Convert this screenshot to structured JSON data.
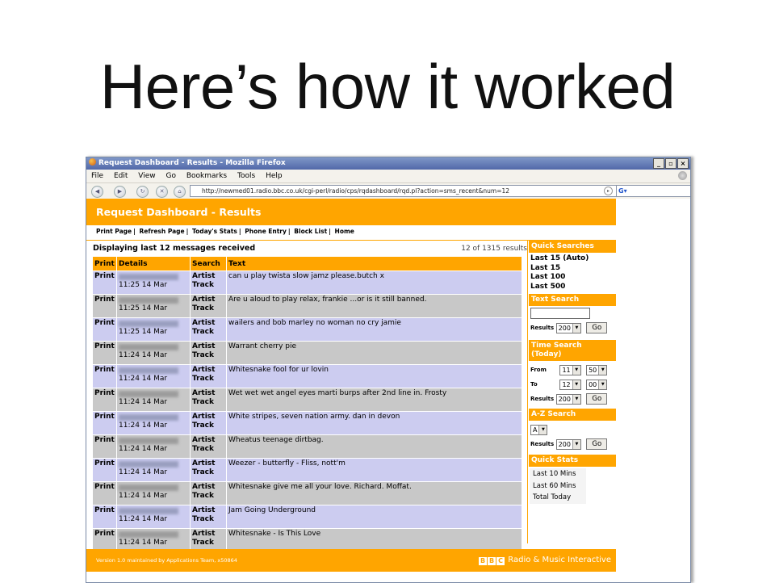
{
  "slide": {
    "title": "Here’s how it worked"
  },
  "window": {
    "title": "Request Dashboard - Results - Mozilla Firefox",
    "menu": [
      "File",
      "Edit",
      "View",
      "Go",
      "Bookmarks",
      "Tools",
      "Help"
    ],
    "url": "http://newmed01.radio.bbc.co.uk/cgi-perl/radio/cps/rqdashboard/rqd.pl?action=sms_recent&num=12",
    "search_logo": "G"
  },
  "page": {
    "header": "Request Dashboard - Results",
    "links": [
      "Print Page",
      "Refresh Page",
      "Today's Stats",
      "Phone Entry",
      "Block List",
      "Home"
    ],
    "display_heading": "Displaying last 12 messages received",
    "result_count": "12 of 1315 results",
    "columns": [
      "Print",
      "Details",
      "Search",
      "Text"
    ],
    "rows": [
      {
        "print": "Print",
        "time": "11:25 14 Mar",
        "s1": "Artist",
        "s2": "Track",
        "text": "can u play twista slow jamz please.butch x"
      },
      {
        "print": "Print",
        "time": "11:25 14 Mar",
        "s1": "Artist",
        "s2": "Track",
        "text": "Are u aloud to play relax, frankie ...or is it still banned."
      },
      {
        "print": "Print",
        "time": "11:25 14 Mar",
        "s1": "Artist",
        "s2": "Track",
        "text": "wailers and bob marley no woman no cry jamie"
      },
      {
        "print": "Print",
        "time": "11:24 14 Mar",
        "s1": "Artist",
        "s2": "Track",
        "text": "Warrant cherry pie"
      },
      {
        "print": "Print",
        "time": "11:24 14 Mar",
        "s1": "Artist",
        "s2": "Track",
        "text": "Whitesnake fool for ur lovin"
      },
      {
        "print": "Print",
        "time": "11:24 14 Mar",
        "s1": "Artist",
        "s2": "Track",
        "text": "Wet wet wet angel eyes marti burps after 2nd line in. Frosty"
      },
      {
        "print": "Print",
        "time": "11:24 14 Mar",
        "s1": "Artist",
        "s2": "Track",
        "text": "White stripes, seven nation army. dan in devon"
      },
      {
        "print": "Print",
        "time": "11:24 14 Mar",
        "s1": "Artist",
        "s2": "Track",
        "text": "Wheatus teenage dirtbag."
      },
      {
        "print": "Print",
        "time": "11:24 14 Mar",
        "s1": "Artist",
        "s2": "Track",
        "text": "Weezer - butterfly - Fliss, nott'm"
      },
      {
        "print": "Print",
        "time": "11:24 14 Mar",
        "s1": "Artist",
        "s2": "Track",
        "text": "Whitesnake give me all your love. Richard. Moffat."
      },
      {
        "print": "Print",
        "time": "11:24 14 Mar",
        "s1": "Artist",
        "s2": "Track",
        "text": "Jam Going Underground"
      },
      {
        "print": "Print",
        "time": "11:24 14 Mar",
        "s1": "Artist",
        "s2": "Track",
        "text": "Whitesnake - Is This Love"
      }
    ],
    "sidebar": {
      "quick_title": "Quick Searches",
      "quick_links": [
        "Last 15 (Auto)",
        "Last 15",
        "Last 100",
        "Last 500"
      ],
      "text_title": "Text Search",
      "results_label": "Results",
      "results_value": "200",
      "go": "Go",
      "time_title": "Time Search (Today)",
      "from_label": "From",
      "from_hour": "11",
      "from_min": "50",
      "to_label": "To",
      "to_hour": "12",
      "to_min": "00",
      "az_title": "A-Z Search",
      "az_value": "A",
      "stats_title": "Quick Stats",
      "stats": [
        "Last 10 Mins",
        "Last 60 Mins",
        "Total Today"
      ]
    },
    "footer": {
      "left": "Version 1.0 maintained by Applications Team, x50864",
      "bbc": "BBC",
      "right": "Radio & Music Interactive"
    }
  },
  "colors": {
    "accent": "#ffa500",
    "row_blue": "#ccccf0",
    "row_grey": "#c8c8c8"
  }
}
